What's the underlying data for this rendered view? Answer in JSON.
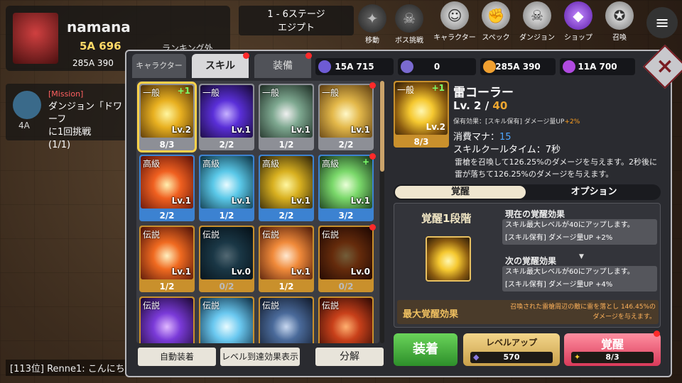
{
  "hud": {
    "player_name": "namana",
    "power": "5A 696",
    "ranking": "ランキング外",
    "gold": "285A 390",
    "stage_line1": "1 - 6ステージ",
    "stage_line2": "エジプト",
    "move_label": "移動",
    "boss_label": "ボス挑戦",
    "nav": [
      "キャラクター",
      "スペック",
      "ダンジョン",
      "ショップ",
      "召喚"
    ],
    "menu_label": "メニュー",
    "mission_tag": "[Mission]",
    "mission_text1": "ダンジョン「ドワーフ",
    "mission_text2": "に1回挑戦",
    "mission_progress": "(1/1)",
    "mission_level": "4A",
    "chat": "[113位] Renne1: こんにち"
  },
  "tabs": [
    "キャラクター",
    "スキル",
    "装備"
  ],
  "resources": [
    {
      "value": "15A 715",
      "color": "#6e5bd4"
    },
    {
      "value": "0",
      "color": "#7a6ad0"
    },
    {
      "value": "285A 390",
      "color": "#f0a030"
    },
    {
      "value": "11A 700",
      "color": "#b04ae0"
    }
  ],
  "skills": [
    {
      "rank": "一般",
      "level": "Lv.2",
      "count": "8/3",
      "plus": "+1",
      "grade": "normal",
      "selected": true,
      "art": [
        "#fff6a0",
        "#e8b020",
        "#4a2c08"
      ]
    },
    {
      "rank": "一般",
      "level": "Lv.1",
      "count": "2/2",
      "grade": "normal",
      "art": [
        "#c7b2ff",
        "#5a2fd8",
        "#14082e"
      ]
    },
    {
      "rank": "一般",
      "level": "Lv.1",
      "count": "1/2",
      "grade": "normal",
      "art": [
        "#f0f0f0",
        "#7ea890",
        "#1c2a22"
      ]
    },
    {
      "rank": "一般",
      "level": "Lv.1",
      "count": "2/2",
      "grade": "normal",
      "art": [
        "#fff8c8",
        "#e3b84a",
        "#5a3a10"
      ]
    },
    {
      "rank": "高級",
      "level": "Lv.1",
      "count": "2/2",
      "grade": "rare",
      "art": [
        "#fff0b0",
        "#f06020",
        "#5a1008"
      ]
    },
    {
      "rank": "高級",
      "level": "Lv.1",
      "count": "1/2",
      "grade": "rare",
      "art": [
        "#e8fbff",
        "#5ac8e8",
        "#0c3040"
      ]
    },
    {
      "rank": "高級",
      "level": "Lv.1",
      "count": "2/2",
      "grade": "rare",
      "art": [
        "#fff7a0",
        "#d8b020",
        "#2a2008"
      ]
    },
    {
      "rank": "高級",
      "level": "Lv.1",
      "count": "3/2",
      "plus": "+",
      "grade": "rare",
      "art": [
        "#eaffd8",
        "#7ad86a",
        "#143018"
      ]
    },
    {
      "rank": "伝説",
      "level": "Lv.1",
      "count": "1/2",
      "grade": "legend",
      "art": [
        "#fff0c0",
        "#f06a20",
        "#4a1008"
      ]
    },
    {
      "rank": "伝説",
      "level": "Lv.0",
      "count": "0/2",
      "grade": "legend",
      "dim": true,
      "art": [
        "#b8e8ff",
        "#3a7a9a",
        "#0a2030"
      ]
    },
    {
      "rank": "伝説",
      "level": "Lv.1",
      "count": "1/2",
      "grade": "legend",
      "art": [
        "#ffe8d0",
        "#f08a3a",
        "#4a1808"
      ]
    },
    {
      "rank": "伝説",
      "level": "Lv.0",
      "count": "0/2",
      "grade": "legend",
      "dim": true,
      "art": [
        "#ffd080",
        "#e0601a",
        "#3a0c04"
      ]
    },
    {
      "rank": "伝説",
      "level": "",
      "count": "",
      "grade": "legend",
      "art": [
        "#e0b8ff",
        "#7a3ad8",
        "#1a0830"
      ]
    },
    {
      "rank": "伝説",
      "level": "",
      "count": "",
      "grade": "legend",
      "art": [
        "#e8fbff",
        "#6ac8f0",
        "#0c2a40"
      ]
    },
    {
      "rank": "伝説",
      "level": "",
      "count": "",
      "grade": "legend",
      "art": [
        "#c8d8f0",
        "#4a6a9a",
        "#101828"
      ]
    },
    {
      "rank": "伝説",
      "level": "",
      "count": "",
      "grade": "legend",
      "art": [
        "#ffb070",
        "#c8401a",
        "#2a0804"
      ]
    }
  ],
  "grid_buttons": [
    "自動装着",
    "レベル到達効果表示",
    "分解"
  ],
  "detail": {
    "name": "雷コーラー",
    "level_prefix": "Lv.  2  /",
    "level_max": "40",
    "icon_level": "Lv.2",
    "icon_rank": "一般",
    "icon_plus": "+1",
    "icon_count": "8/3",
    "passive_prefix": "保有効果：[スキル保有] ダメージ量UP",
    "passive_value": "+2%",
    "mana_label": "消費マナ：",
    "mana_value": "15",
    "cooldown": "スキルクールタイム：7秒",
    "desc_line1": "雷槍を召喚して126.25%のダメージを与えます。2秒後に",
    "desc_line2": "雷が落ちて126.25%のダメージを与えます。",
    "seg_active": "覚醒",
    "seg_inactive": "オプション",
    "awake_stage": "覚醒1段階",
    "current_title": "現在の覚醒効果",
    "current_line1": "スキル最大レベルが40にアップします。",
    "current_line2": "[スキル保有] ダメージ量UP +2%",
    "next_title": "次の覚醒効果",
    "next_line1": "スキル最大レベルが60にアップします。",
    "next_line2": "[スキル保有] ダメージ量UP +4%",
    "max_title": "最大覚醒効果",
    "max_line1": "召喚された雷槍周辺の敵に雷を落とし 146.45%の",
    "max_line2": "ダメージを与えます。",
    "equip_label": "装着",
    "levelup_label": "レベルアップ",
    "levelup_cost": "570",
    "awake_label": "覚醒",
    "awake_cost": "8/3"
  }
}
